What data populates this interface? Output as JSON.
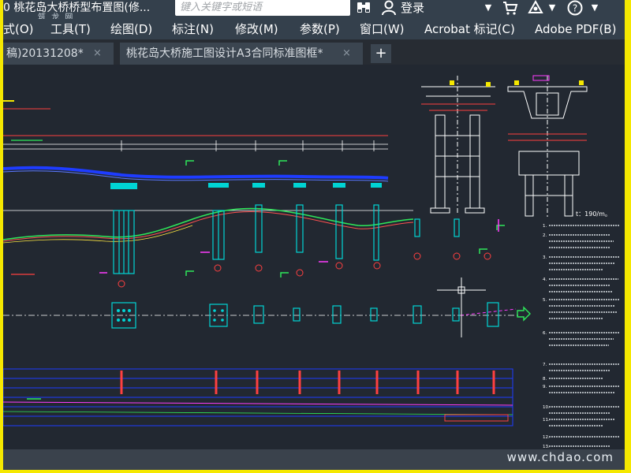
{
  "window": {
    "title": "0 桃花岛大桥桥型布置图(修...",
    "title_watermark": "筑 龙 网"
  },
  "toolbar": {
    "search_placeholder": "键入关键字或短语",
    "login_label": "登录",
    "icons": [
      "binoculars-icon",
      "user-icon",
      "dropdown-arrow-icon",
      "cart-icon",
      "exchange-icon",
      "help-icon"
    ]
  },
  "menu": {
    "items": [
      "式(O)",
      "工具(T)",
      "绘图(D)",
      "标注(N)",
      "修改(M)",
      "参数(P)",
      "窗口(W)",
      "Acrobat 标记(C)",
      "Adobe PDF(B)"
    ]
  },
  "tabs": [
    {
      "label": "稿)20131208*",
      "close": "×"
    },
    {
      "label": "桃花岛大桥施工图设计A3合同标准图框*",
      "close": "×"
    }
  ],
  "tab_add_label": "+",
  "drawing": {
    "note_top": "t：190/m。",
    "notes": [
      "1.",
      "2.",
      "3.",
      "4.",
      "5.",
      "6.",
      "7.",
      "8.",
      "9.",
      "10.",
      "11.",
      "12.",
      "13."
    ]
  },
  "watermark": "www.chdao.com",
  "colors": {
    "frame_border": "#f5e800",
    "title_bar": "#34404c",
    "canvas_bg": "#222831",
    "blue_line": "#1e3cff",
    "green_line": "#2ee85a",
    "cyan_line": "#00d4d4",
    "red_text": "#ff3030",
    "magenta_line": "#ff3cff"
  }
}
